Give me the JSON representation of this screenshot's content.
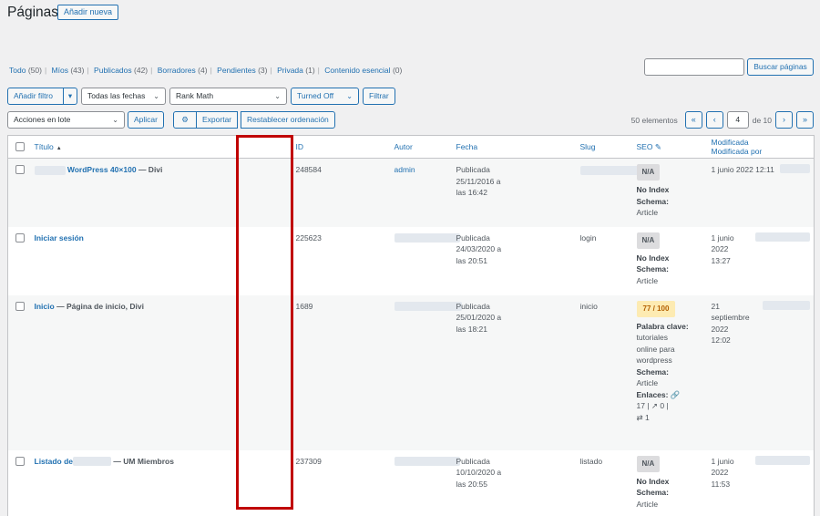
{
  "header": {
    "title": "Páginas",
    "add_new": "Añadir nueva"
  },
  "filters_nav": [
    {
      "label": "Todo",
      "count": "(50)"
    },
    {
      "label": "Míos",
      "count": "(43)"
    },
    {
      "label": "Publicados",
      "count": "(42)"
    },
    {
      "label": "Borradores",
      "count": "(4)"
    },
    {
      "label": "Pendientes",
      "count": "(3)"
    },
    {
      "label": "Privada",
      "count": "(1)"
    },
    {
      "label": "Contenido esencial",
      "count": "(0)"
    }
  ],
  "search": {
    "button": "Buscar páginas",
    "value": ""
  },
  "toolbar": {
    "add_filter": "Añadir filtro",
    "dates": "Todas las fechas",
    "rank_math": "Rank Math",
    "turned_off": "Turned Off",
    "filter": "Filtrar",
    "bulk_actions": "Acciones en lote",
    "apply": "Aplicar",
    "export": "Exportar",
    "reset_order": "Restablecer ordenación"
  },
  "pagination": {
    "total": "50 elementos",
    "current": "4",
    "of": "de 10",
    "first": "«",
    "prev": "‹",
    "next": "›",
    "last": "»"
  },
  "columns": {
    "title": "Título",
    "id": "ID",
    "author": "Autor",
    "date": "Fecha",
    "slug": "Slug",
    "seo": "SEO",
    "modified": "Modificada",
    "modified_by": "Modificada por"
  },
  "rows": [
    {
      "title": "WordPress 40×100",
      "suffix": "— Divi",
      "id": "248584",
      "author": "admin",
      "date_status": "Publicada",
      "date_1": "25/11/2016 a",
      "date_2": "las 16:42",
      "slug": "",
      "seo_badge": "N/A",
      "seo_1": "No Index",
      "seo_2": "Schema:",
      "seo_3": "Article",
      "modified_1": "1 junio 2022 12:11",
      "modified_2": ""
    },
    {
      "title": "Iniciar sesión",
      "suffix": "",
      "id": "225623",
      "author": "",
      "date_status": "Publicada",
      "date_1": "24/03/2020 a",
      "date_2": "las 20:51",
      "slug": "login",
      "seo_badge": "N/A",
      "seo_1": "No Index",
      "seo_2": "Schema:",
      "seo_3": "Article",
      "modified_1": "1 junio 2022",
      "modified_2": "13:27"
    },
    {
      "title": "Inicio",
      "suffix": "— Página de inicio, Divi",
      "id": "1689",
      "author": "",
      "date_status": "Publicada",
      "date_1": "25/01/2020 a",
      "date_2": "las 18:21",
      "slug": "inicio",
      "seo_badge": "77 / 100",
      "seo_kw_label": "Palabra clave:",
      "seo_kw": "tutoriales online para wordpress",
      "seo_2": "Schema:",
      "seo_3": "Article",
      "seo_links_label": "Enlaces:",
      "seo_links_1": "17",
      "seo_links_2": "0",
      "seo_links_3": "1",
      "modified_1": "21 septiembre",
      "modified_2": "2022 12:02"
    },
    {
      "title": "Listado de",
      "suffix": "— UM Miembros",
      "id": "237309",
      "author": "",
      "date_status": "Publicada",
      "date_1": "10/10/2020 a",
      "date_2": "las 20:55",
      "slug": "listado",
      "seo_badge": "N/A",
      "seo_1": "No Index",
      "seo_2": "Schema:",
      "seo_3": "Article",
      "modified_1": "1 junio 2022",
      "modified_2": "11:53"
    }
  ]
}
